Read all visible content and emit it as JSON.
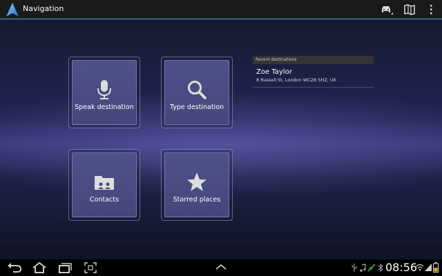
{
  "app": {
    "title": "Navigation"
  },
  "tiles": [
    {
      "label": "Speak destination",
      "icon": "microphone-icon"
    },
    {
      "label": "Type destination",
      "icon": "search-icon"
    },
    {
      "label": "Contacts",
      "icon": "contacts-folder-icon"
    },
    {
      "label": "Starred places",
      "icon": "star-icon"
    }
  ],
  "recent": {
    "header": "Recent destinations",
    "items": [
      {
        "name": "Zoe Taylor",
        "address": "8 Russell St, London WC2B 5HZ, UK"
      }
    ]
  },
  "status": {
    "time": "08:56"
  },
  "colors": {
    "accent": "#31b6e7",
    "tile": "#4e5088"
  }
}
